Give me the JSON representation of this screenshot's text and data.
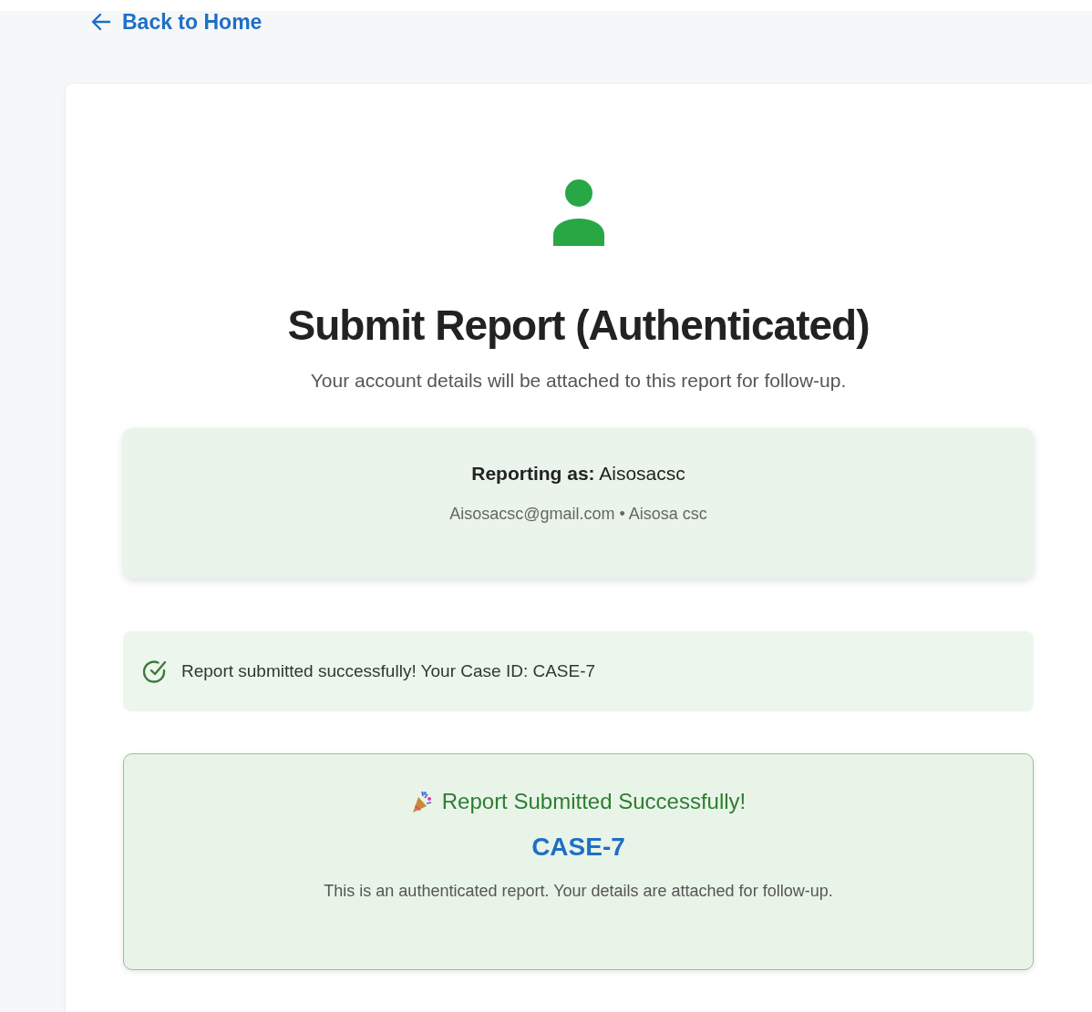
{
  "back_link": {
    "label": "Back to Home"
  },
  "header": {
    "title": "Submit Report (Authenticated)",
    "subtitle": "Your account details will be attached to this report for follow-up."
  },
  "reporter": {
    "label": "Reporting as:",
    "name": "Aisosacsc",
    "details": "Aisosacsc@gmail.com • Aisosa csc"
  },
  "alert": {
    "message": "Report submitted successfully! Your Case ID: CASE-7"
  },
  "success_panel": {
    "heading": "Report Submitted Successfully!",
    "case_id": "CASE-7",
    "note": "This is an authenticated report. Your details are attached for follow-up."
  }
}
